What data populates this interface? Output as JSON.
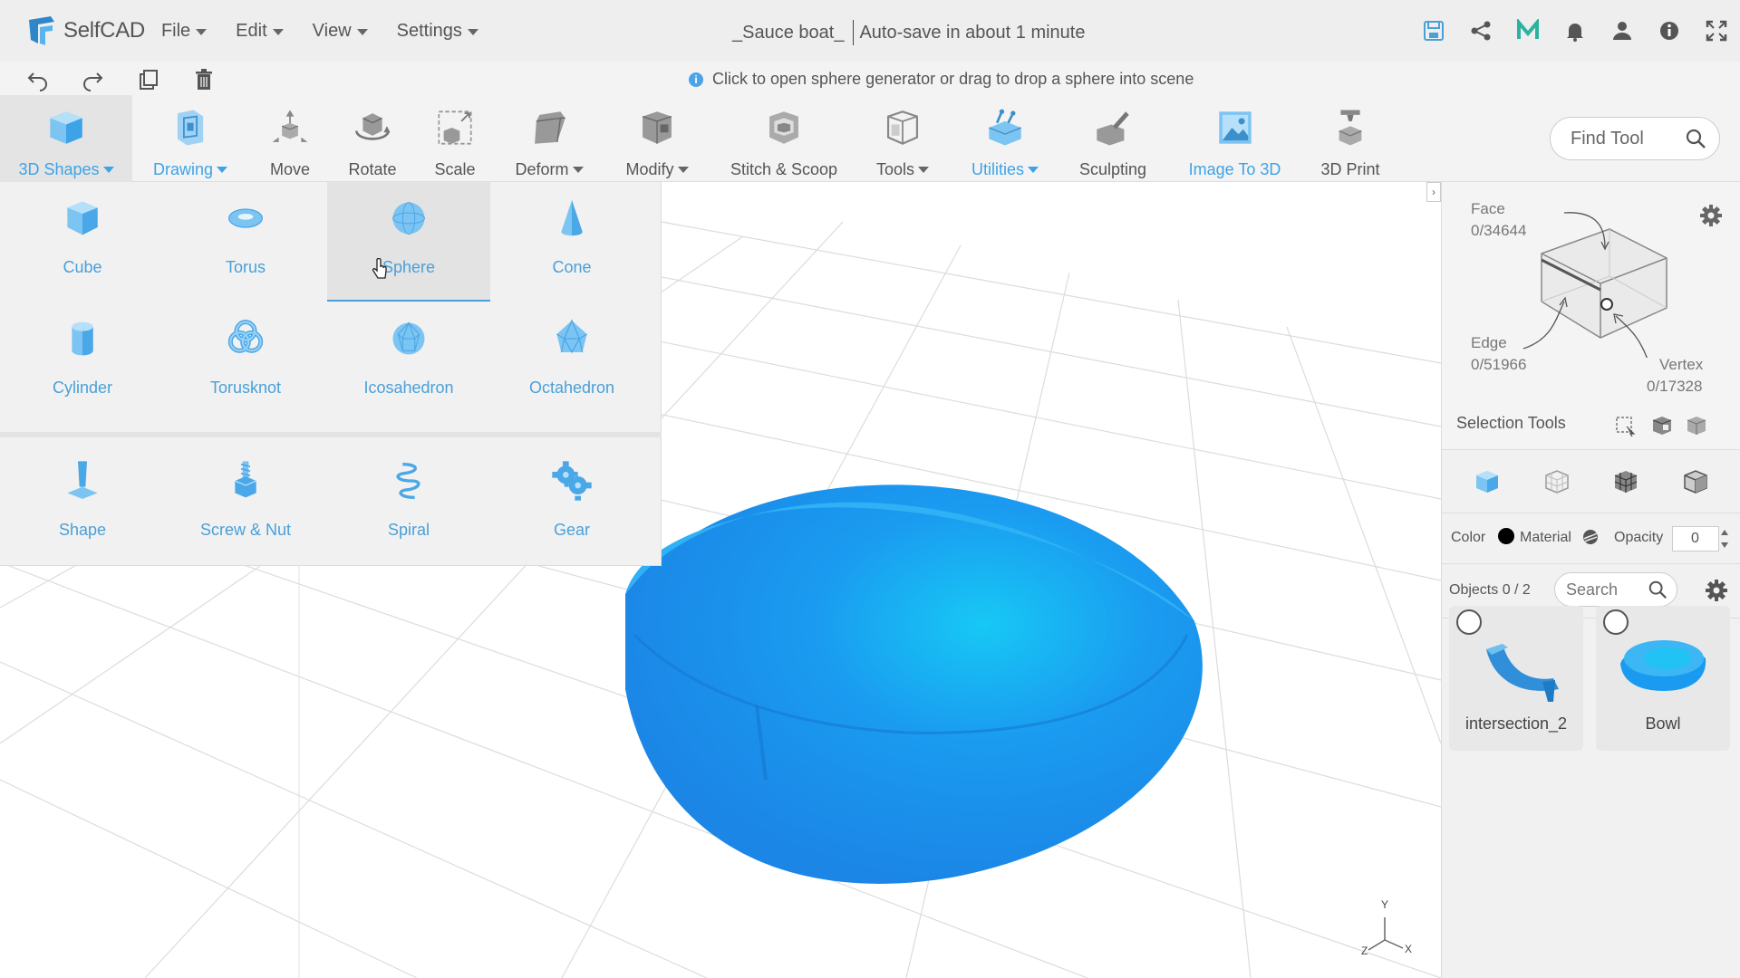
{
  "app": {
    "name": "SelfCAD"
  },
  "menu": {
    "file": "File",
    "edit": "Edit",
    "view": "View",
    "settings": "Settings"
  },
  "document": {
    "title": "_Sauce boat_",
    "autosave": "Auto-save in about 1 minute"
  },
  "hint": "Click to open sphere generator or drag to drop a sphere into scene",
  "toolbar": {
    "items": [
      {
        "label": "3D Shapes",
        "icon": "cube-icon"
      },
      {
        "label": "Drawing",
        "icon": "drawing-icon"
      },
      {
        "label": "Move",
        "icon": "move-icon"
      },
      {
        "label": "Rotate",
        "icon": "rotate-icon"
      },
      {
        "label": "Scale",
        "icon": "scale-icon"
      },
      {
        "label": "Deform",
        "icon": "deform-icon"
      },
      {
        "label": "Modify",
        "icon": "modify-icon"
      },
      {
        "label": "Stitch & Scoop",
        "icon": "stitch-scoop-icon"
      },
      {
        "label": "Tools",
        "icon": "tools-icon"
      },
      {
        "label": "Utilities",
        "icon": "utilities-icon"
      },
      {
        "label": "Sculpting",
        "icon": "sculpting-icon"
      },
      {
        "label": "Image To 3D",
        "icon": "image-to-3d-icon"
      },
      {
        "label": "3D Print",
        "icon": "3d-print-icon"
      }
    ],
    "find_tool": "Find Tool"
  },
  "shapes": {
    "row1": [
      "Cube",
      "Torus",
      "Sphere",
      "Cone"
    ],
    "row2": [
      "Cylinder",
      "Torusknot",
      "Icosahedron",
      "Octahedron"
    ],
    "row3": [
      "Shape",
      "Screw & Nut",
      "Spiral",
      "Gear"
    ],
    "selected": "Sphere"
  },
  "selection": {
    "face_label": "Face",
    "face_count": "0/34644",
    "edge_label": "Edge",
    "edge_count": "0/51966",
    "vertex_label": "Vertex",
    "vertex_count": "0/17328",
    "tools_label": "Selection Tools"
  },
  "appearance": {
    "color_label": "Color",
    "material_label": "Material",
    "opacity_label": "Opacity",
    "opacity_value": "0"
  },
  "objects": {
    "label": "Objects 0 / 2",
    "search_placeholder": "Search",
    "items": [
      {
        "name": "intersection_2"
      },
      {
        "name": "Bowl"
      }
    ]
  },
  "axes": {
    "x": "X",
    "y": "Y",
    "z": "Z"
  },
  "colors": {
    "accent": "#3da3e8",
    "object": "#1a9bf0"
  }
}
